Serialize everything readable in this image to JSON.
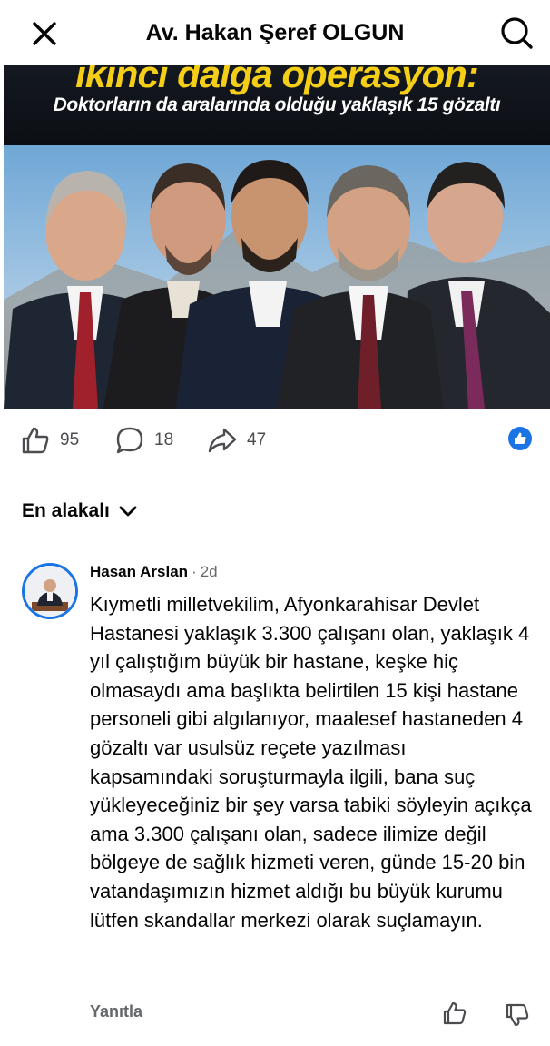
{
  "header": {
    "title": "Av. Hakan Şeref OLGUN",
    "close_icon": "close-icon",
    "search_icon": "search-icon"
  },
  "post_image": {
    "headline": "ikinci dalga operasyon:",
    "subheadline": "Doktorların da aralarında olduğu yaklaşık 15 gözaltı",
    "headline_color": "#f5cf17"
  },
  "actions": {
    "like_count": "95",
    "comment_count": "18",
    "share_count": "47",
    "reaction_badge": "like-reaction-icon",
    "accent": "#1b74e4"
  },
  "sort": {
    "label": "En alakalı"
  },
  "comment": {
    "author": "Hasan Arslan",
    "separator": "·",
    "time": "2d",
    "text": "Kıymetli milletvekilim, Afyonkarahisar Devlet Hastanesi yaklaşık 3.300 çalışanı olan, yaklaşık 4 yıl çalıştığım büyük bir hastane, keşke hiç olmasaydı ama başlıkta belirtilen 15 kişi hastane personeli gibi algılanıyor, maalesef hastaneden 4 gözaltı var usulsüz reçete yazılması kapsamındaki soruşturmayla ilgili, bana suç yükleyeceğiniz bir şey varsa tabiki söyleyin açıkça ama 3.300 çalışanı olan, sadece ilimize değil bölgeye de sağlık hizmeti veren, günde 15-20 bin vatandaşımızın hizmet aldığı bu büyük kurumu lütfen skandallar merkezi olarak suçlamayın.",
    "reply_label": "Yanıtla"
  }
}
